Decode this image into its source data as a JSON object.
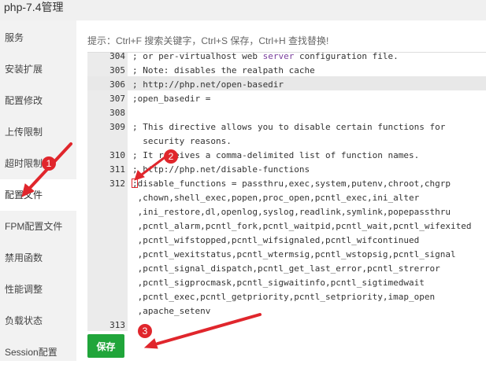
{
  "window": {
    "title": "php-7.4管理"
  },
  "sidebar": {
    "items": [
      {
        "label": "服务"
      },
      {
        "label": "安装扩展"
      },
      {
        "label": "配置修改"
      },
      {
        "label": "上传限制"
      },
      {
        "label": "超时限制"
      },
      {
        "label": "配置文件",
        "active": true
      },
      {
        "label": "FPM配置文件"
      },
      {
        "label": "禁用函数"
      },
      {
        "label": "性能调整"
      },
      {
        "label": "负载状态"
      },
      {
        "label": "Session配置"
      }
    ]
  },
  "editor": {
    "hint": "提示：Ctrl+F 搜索关键字，Ctrl+S 保存，Ctrl+H 查找替换!",
    "lines": [
      {
        "num": "304",
        "text": "; or per-virtualhost web server configuration file."
      },
      {
        "num": "305",
        "text": "; Note: disables the realpath cache"
      },
      {
        "num": "306",
        "text": "; http://php.net/open-basedir"
      },
      {
        "num": "307",
        "text": ";open_basedir ="
      },
      {
        "num": "308",
        "text": ""
      },
      {
        "num": "309",
        "text": "; This directive allows you to disable certain functions for"
      },
      {
        "num": "",
        "text": "  security reasons."
      },
      {
        "num": "310",
        "text": "; It receives a comma-delimited list of function names."
      },
      {
        "num": "311",
        "text": "; http://php.net/disable-functions"
      },
      {
        "num": "312",
        "text": ";disable_functions = passthru,exec,system,putenv,chroot,chgrp"
      },
      {
        "num": "",
        "text": " ,chown,shell_exec,popen,proc_open,pcntl_exec,ini_alter"
      },
      {
        "num": "",
        "text": " ,ini_restore,dl,openlog,syslog,readlink,symlink,popepassthru"
      },
      {
        "num": "",
        "text": " ,pcntl_alarm,pcntl_fork,pcntl_waitpid,pcntl_wait,pcntl_wifexited"
      },
      {
        "num": "",
        "text": " ,pcntl_wifstopped,pcntl_wifsignaled,pcntl_wifcontinued"
      },
      {
        "num": "",
        "text": " ,pcntl_wexitstatus,pcntl_wtermsig,pcntl_wstopsig,pcntl_signal"
      },
      {
        "num": "",
        "text": " ,pcntl_signal_dispatch,pcntl_get_last_error,pcntl_strerror"
      },
      {
        "num": "",
        "text": " ,pcntl_sigprocmask,pcntl_sigwaitinfo,pcntl_sigtimedwait"
      },
      {
        "num": "",
        "text": " ,pcntl_exec,pcntl_getpriority,pcntl_setpriority,imap_open"
      },
      {
        "num": "",
        "text": " ,apache_setenv"
      },
      {
        "num": "",
        "text": ""
      },
      {
        "num": "313",
        "text": ""
      }
    ]
  },
  "save_button": {
    "label": "保存"
  },
  "annotations": {
    "badges": [
      "1",
      "2",
      "3"
    ],
    "color": "#e0262c"
  },
  "colors": {
    "accent": "#20a53a",
    "keyword": "#7a3e9d",
    "annotation": "#e0262c"
  }
}
